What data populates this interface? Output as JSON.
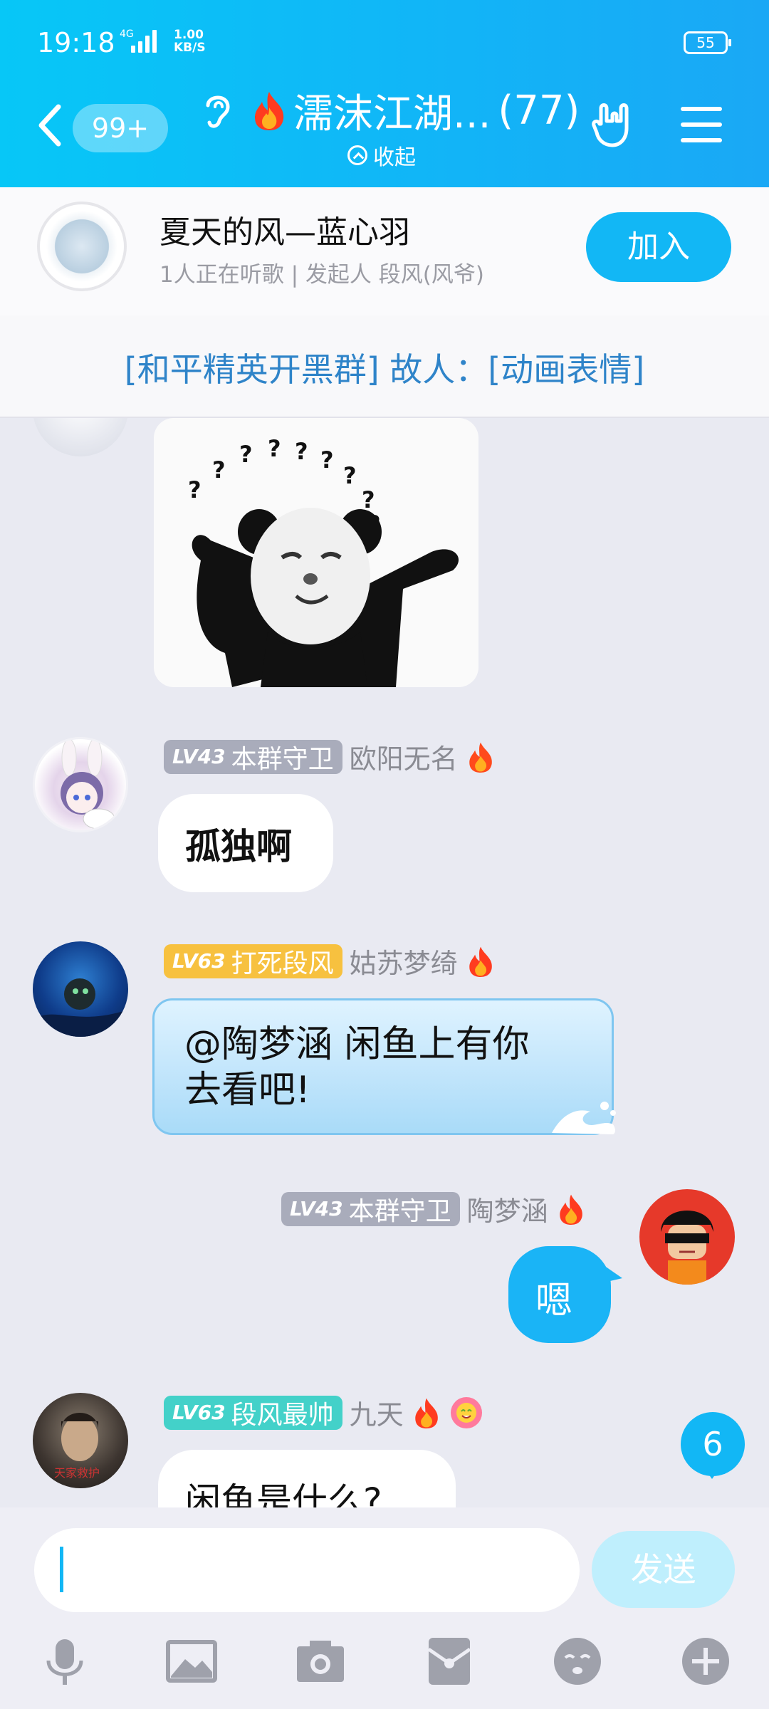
{
  "status_bar": {
    "time": "19:18",
    "network": "4G",
    "speed_value": "1.00",
    "speed_unit": "KB/S",
    "battery": "55"
  },
  "header": {
    "back_badge": "99+",
    "title": "濡沫江湖...",
    "member_count": "(77)",
    "collapse_label": "收起"
  },
  "music": {
    "title": "夏天的风—蓝心羽",
    "subtitle": "1人正在听歌 | 发起人 段风(风爷)",
    "join_label": "加入"
  },
  "notice": {
    "text": "[和平精英开黑群] 故人：[动画表情]"
  },
  "messages": [
    {
      "level": "LV43",
      "title": "本群守卫",
      "name": "欧阳无名",
      "text": "孤独啊"
    },
    {
      "level": "LV63",
      "title": "打死段风",
      "name": "姑苏梦绮",
      "text_line1": "@陶梦涵 闲鱼上有你",
      "text_line2": "去看吧!"
    },
    {
      "level": "LV43",
      "title": "本群守卫",
      "name": "陶梦涵",
      "text": "嗯"
    },
    {
      "level": "LV63",
      "title": "段风最帅",
      "name": "九天",
      "text": "闲鱼是什么?",
      "avatar_caption": "天家救护"
    }
  ],
  "sticker": {
    "marks": [
      "?",
      "?",
      "?",
      "?",
      "?",
      "?",
      "?",
      "?"
    ]
  },
  "unread_count": "6",
  "input": {
    "send_label": "发送"
  },
  "colors": {
    "accent": "#12b7f5",
    "level_gray": "#a9acbb",
    "level_gold": "#f7c13f",
    "level_teal": "#43d1c9",
    "notice_text": "#2f84c9"
  },
  "toolbar": [
    "mic-icon",
    "image-icon",
    "camera-icon",
    "red-packet-icon",
    "emoji-icon",
    "plus-icon"
  ]
}
